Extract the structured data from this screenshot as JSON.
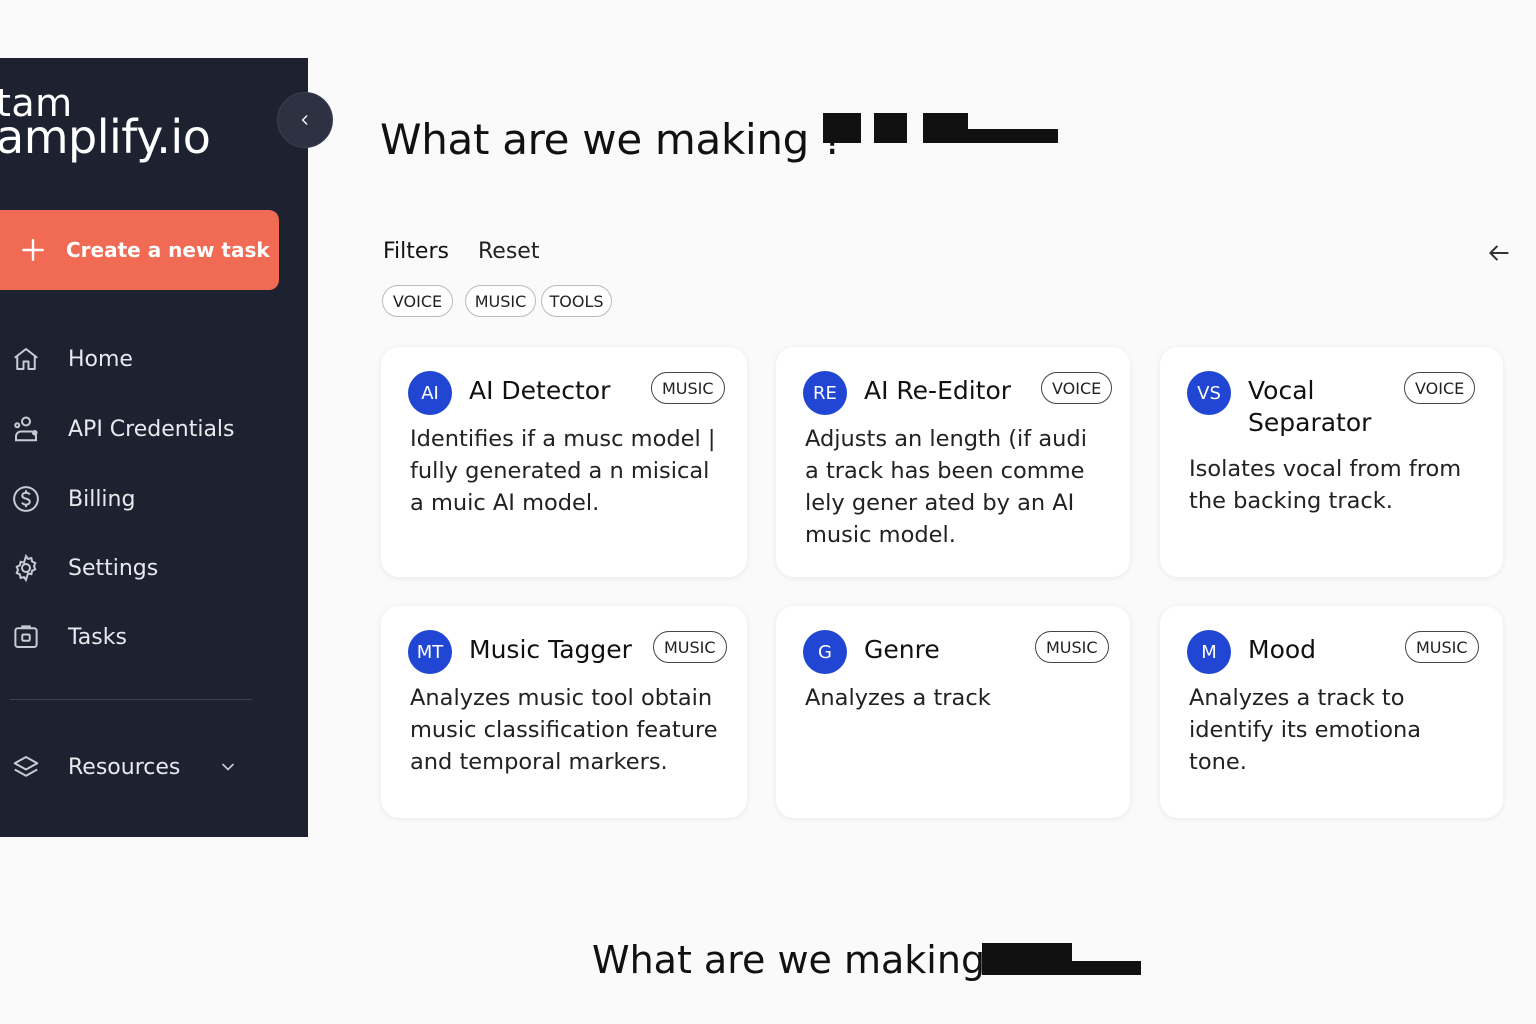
{
  "brand": {
    "line1": "tam",
    "line2": "amplify.io"
  },
  "sidebar": {
    "create_label": "Create a new task",
    "items": [
      {
        "label": "Home",
        "icon": "home-icon"
      },
      {
        "label": "API Credentials",
        "icon": "user-key-icon"
      },
      {
        "label": "Billing",
        "icon": "dollar-icon"
      },
      {
        "label": "Settings",
        "icon": "gear-icon"
      },
      {
        "label": "Tasks",
        "icon": "clipboard-icon"
      }
    ],
    "resources_label": "Resources"
  },
  "main": {
    "title": "What are we making ?",
    "filters_label": "Filters",
    "reset_label": "Reset",
    "chips": [
      "VOICE",
      "MUSIC",
      "TOOLS"
    ],
    "cards": [
      {
        "initials": "AI",
        "title": "AI Detector",
        "badge": "MUSIC",
        "desc": "Identifies if a musc model |\nfully generated a n misical\na muic AI model."
      },
      {
        "initials": "RE",
        "title": "AI Re-Editor",
        "badge": "VOICE",
        "desc": "Adjusts an length (if audi\na track has been comme\nlely gener ated by an AI\nmusic  model."
      },
      {
        "initials": "VS",
        "title": "Vocal\nSeparator",
        "badge": "VOICE",
        "desc": "Isolates vocal from from\nthe backing track."
      },
      {
        "initials": "MT",
        "title": "Music Tagger",
        "badge": "MUSIC",
        "desc": "Analyzes music tool obtain\nmusic classification feature\nand temporal markers."
      },
      {
        "initials": "G",
        "title": "Genre",
        "badge": "MUSIC",
        "desc": "Analyzes a track"
      },
      {
        "initials": "M",
        "title": "Mood",
        "badge": "MUSIC",
        "desc": "Analyzes a track to\nidentify its emotiona\ntone."
      }
    ],
    "footer_title": "What are we making  ’"
  },
  "colors": {
    "sidebar_bg": "#1e2130",
    "accent": "#f06a54",
    "avatar": "#2146d3"
  }
}
